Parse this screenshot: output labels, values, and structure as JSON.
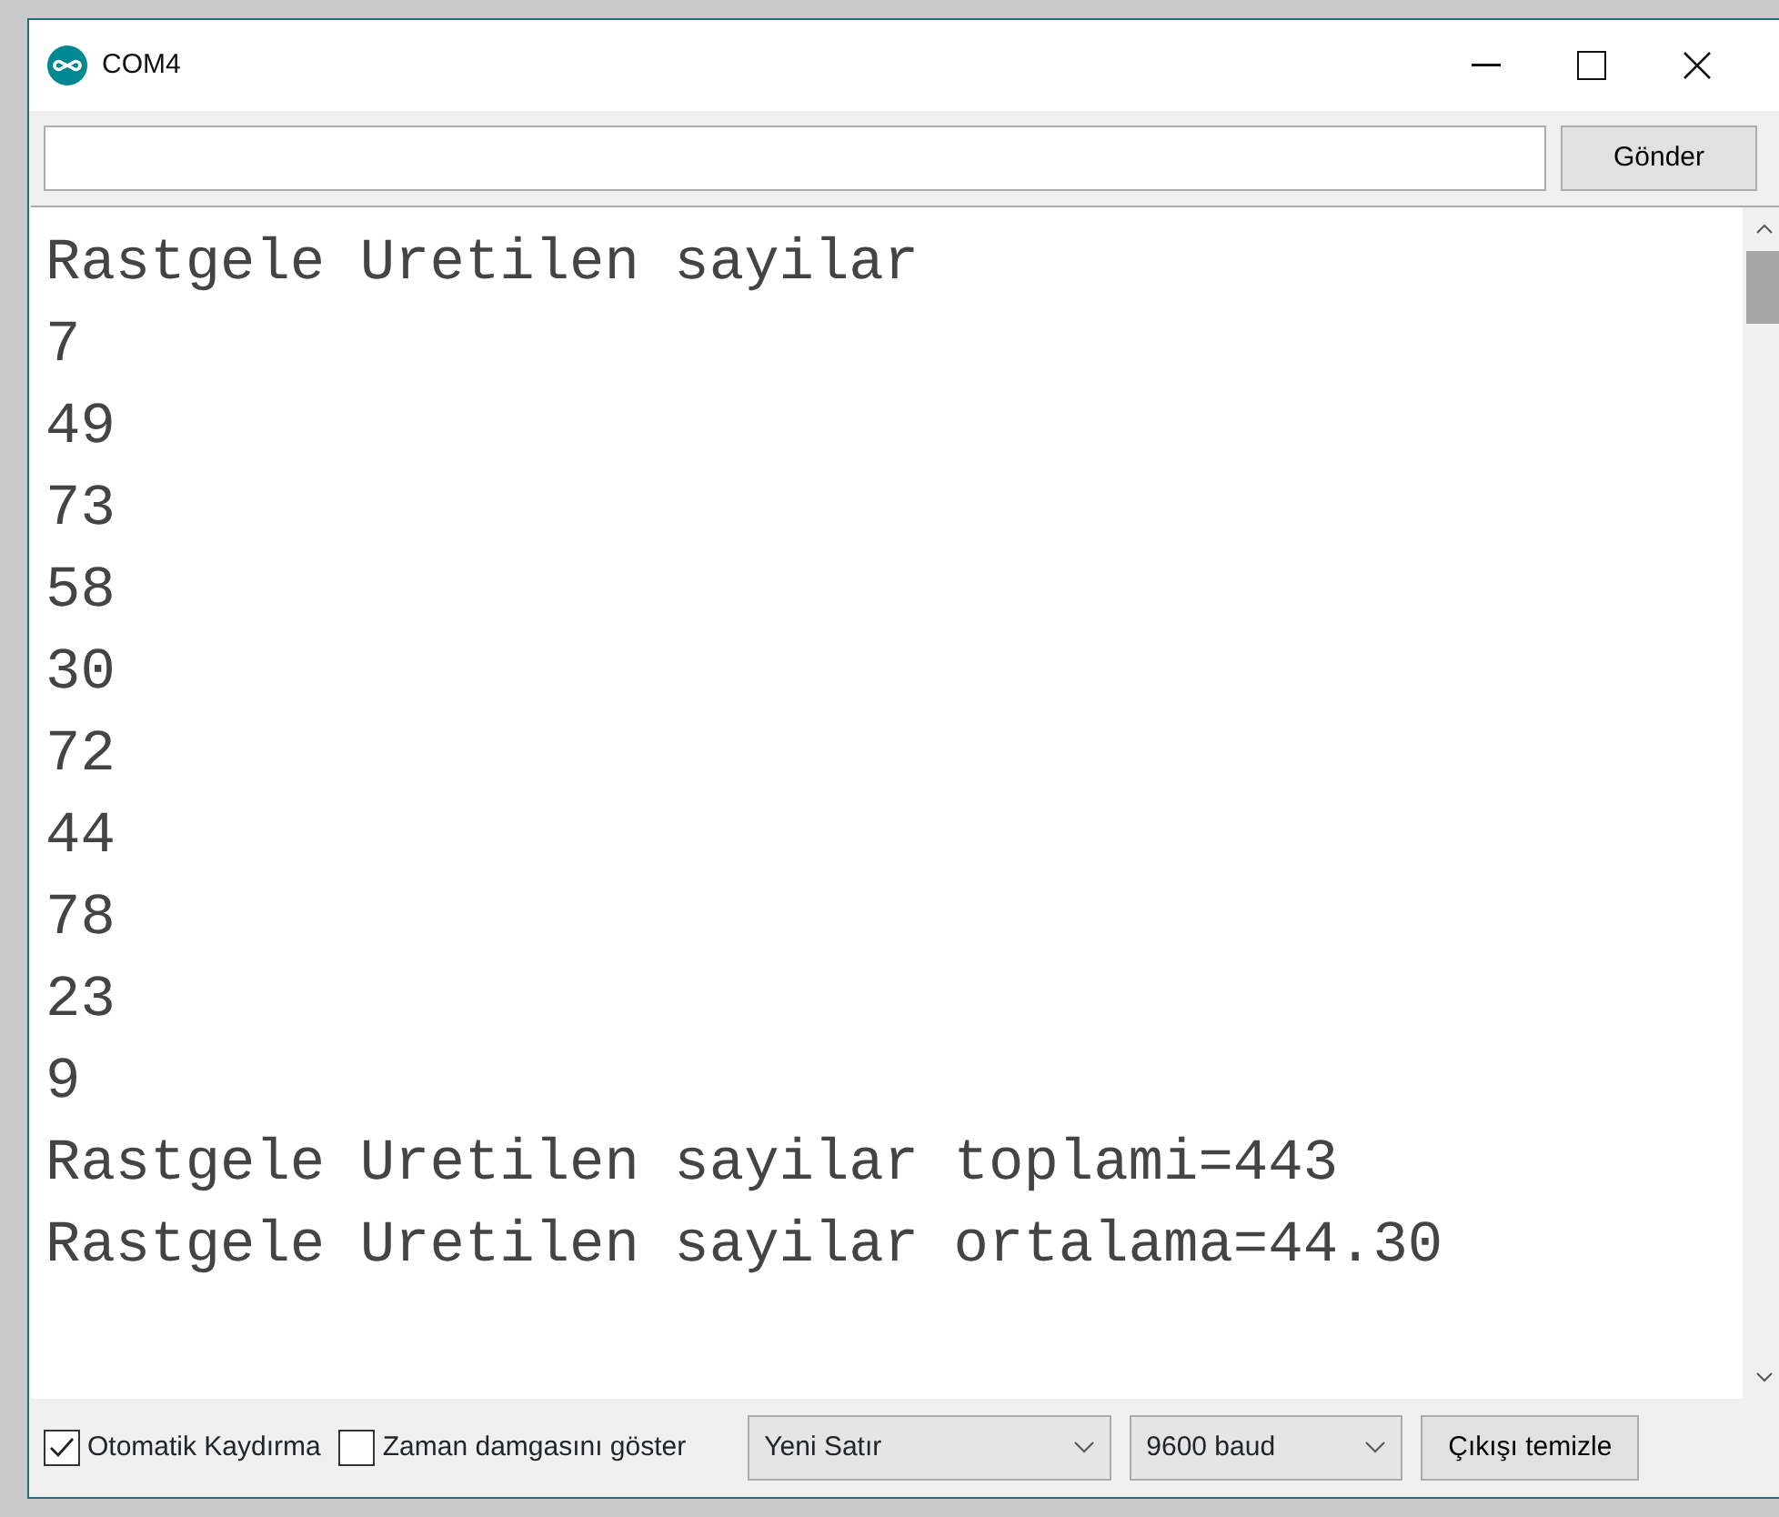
{
  "window": {
    "title": "COM4"
  },
  "send": {
    "label": "Gönder"
  },
  "output": {
    "lines": [
      "Rastgele Uretilen sayilar",
      "7",
      "49",
      "73",
      "58",
      "30",
      "72",
      "44",
      "78",
      "23",
      "9",
      "Rastgele Uretilen sayilar toplami=443",
      "Rastgele Uretilen sayilar ortalama=44.30"
    ]
  },
  "footer": {
    "checkboxes": [
      {
        "label": "Otomatik Kaydırma",
        "checked": true
      },
      {
        "label": "Zaman damgasını göster",
        "checked": false
      }
    ],
    "dropdowns": [
      {
        "value": "Yeni Satır"
      },
      {
        "value": "9600 baud"
      }
    ],
    "clear_button": "Çıkışı temizle"
  }
}
